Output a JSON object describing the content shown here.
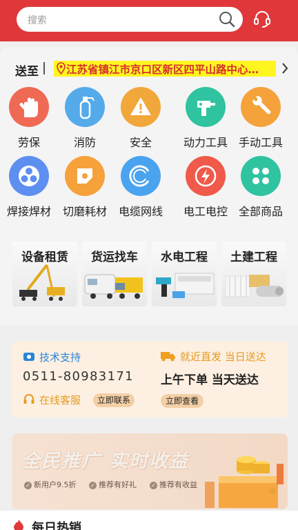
{
  "search": {
    "placeholder": "搜索"
  },
  "address": {
    "label": "送至",
    "value": "江苏省镇江市京口区新区四平山路中心…"
  },
  "categories": [
    {
      "label": "劳保",
      "icon": "glove-icon",
      "color": "#ef6a55"
    },
    {
      "label": "消防",
      "icon": "fire-extinguisher-icon",
      "color": "#55aaea"
    },
    {
      "label": "安全",
      "icon": "warning-icon",
      "color": "#f2a73a"
    },
    {
      "label": "动力工具",
      "icon": "drill-icon",
      "color": "#2fc3a0"
    },
    {
      "label": "手动工具",
      "icon": "wrench-icon",
      "color": "#f5a23b"
    },
    {
      "label": "焊接焊材",
      "icon": "weld-icon",
      "color": "#5c8ff0"
    },
    {
      "label": "切磨耗材",
      "icon": "grinding-disc-icon",
      "color": "#f5a23b"
    },
    {
      "label": "电缆网线",
      "icon": "cable-icon",
      "color": "#4aa3ee"
    },
    {
      "label": "电工电控",
      "icon": "lightning-icon",
      "color": "#ef5a4a"
    },
    {
      "label": "全部商品",
      "icon": "grid-icon",
      "color": "#2fc3a0"
    }
  ],
  "banners": [
    {
      "title": "设备租赁"
    },
    {
      "title": "货运找车"
    },
    {
      "title": "水电工程"
    },
    {
      "title": "土建工程"
    }
  ],
  "support": {
    "title": "技术支持",
    "phone": "0511-80983171",
    "online": "在线客服",
    "contact_button": "立即联系"
  },
  "delivery": {
    "title": "就近直发 当日送达",
    "slogan": "上午下单 当天送达",
    "view_button": "立即查看"
  },
  "ad": {
    "title": "全民推广 实时收益",
    "tags": [
      "新用户9.5折",
      "推荐有好礼",
      "推荐有收益"
    ]
  },
  "hot": {
    "title": "每日热销"
  },
  "colors": {
    "brand_red": "#e0383a",
    "address_highlight": "#fff51f",
    "support_blue": "#2a84d8",
    "accent_orange": "#e79a20"
  }
}
